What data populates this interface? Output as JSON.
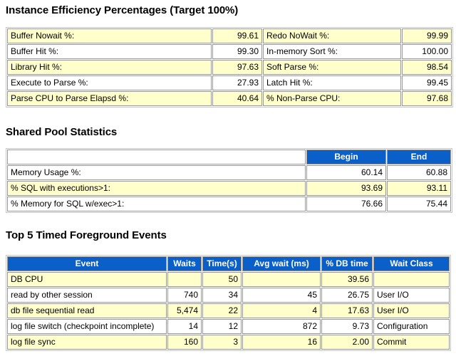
{
  "theme": {
    "header_blue": "#0a5fc8",
    "band_yellow": "#ffffcc",
    "band_white": "#ffffff",
    "border_gray": "#999999",
    "text_black": "#000000"
  },
  "sections": {
    "instance_efficiency": {
      "title": "Instance Efficiency Percentages (Target 100%)",
      "rows": [
        {
          "label_left": "Buffer Nowait %:",
          "value_left": "99.61",
          "label_right": "Redo NoWait %:",
          "value_right": "99.99",
          "band": "y"
        },
        {
          "label_left": "Buffer Hit %:",
          "value_left": "99.30",
          "label_right": "In-memory Sort %:",
          "value_right": "100.00",
          "band": "w"
        },
        {
          "label_left": "Library Hit %:",
          "value_left": "97.63",
          "label_right": "Soft Parse %:",
          "value_right": "98.54",
          "band": "y"
        },
        {
          "label_left": "Execute to Parse %:",
          "value_left": "27.93",
          "label_right": "Latch Hit %:",
          "value_right": "99.45",
          "band": "w"
        },
        {
          "label_left": "Parse CPU to Parse Elapsd %:",
          "value_left": "40.64",
          "label_right": "% Non-Parse CPU:",
          "value_right": "97.68",
          "band": "y"
        }
      ]
    },
    "shared_pool": {
      "title": "Shared Pool Statistics",
      "headers": {
        "metric": "",
        "begin": "Begin",
        "end": "End"
      },
      "rows": [
        {
          "metric": "Memory Usage %:",
          "begin": "60.14",
          "end": "60.88",
          "band": "w"
        },
        {
          "metric": "% SQL with executions>1:",
          "begin": "93.69",
          "end": "93.11",
          "band": "y"
        },
        {
          "metric": "% Memory for SQL w/exec>1:",
          "begin": "76.66",
          "end": "75.44",
          "band": "w"
        }
      ]
    },
    "top_events": {
      "title": "Top 5 Timed Foreground Events",
      "headers": [
        "Event",
        "Waits",
        "Time(s)",
        "Avg wait (ms)",
        "% DB time",
        "Wait Class"
      ],
      "rows": [
        {
          "event": "DB CPU",
          "waits": "",
          "time_s": "50",
          "avg_wait_ms": "",
          "pct_db_time": "39.56",
          "wait_class": "",
          "band": "y"
        },
        {
          "event": "read by other session",
          "waits": "740",
          "time_s": "34",
          "avg_wait_ms": "45",
          "pct_db_time": "26.75",
          "wait_class": "User I/O",
          "band": "w"
        },
        {
          "event": "db file sequential read",
          "waits": "5,474",
          "time_s": "22",
          "avg_wait_ms": "4",
          "pct_db_time": "17.63",
          "wait_class": "User I/O",
          "band": "y"
        },
        {
          "event": "log file switch (checkpoint incomplete)",
          "waits": "14",
          "time_s": "12",
          "avg_wait_ms": "872",
          "pct_db_time": "9.73",
          "wait_class": "Configuration",
          "band": "w"
        },
        {
          "event": "log file sync",
          "waits": "160",
          "time_s": "3",
          "avg_wait_ms": "16",
          "pct_db_time": "2.00",
          "wait_class": "Commit",
          "band": "y"
        }
      ]
    }
  }
}
